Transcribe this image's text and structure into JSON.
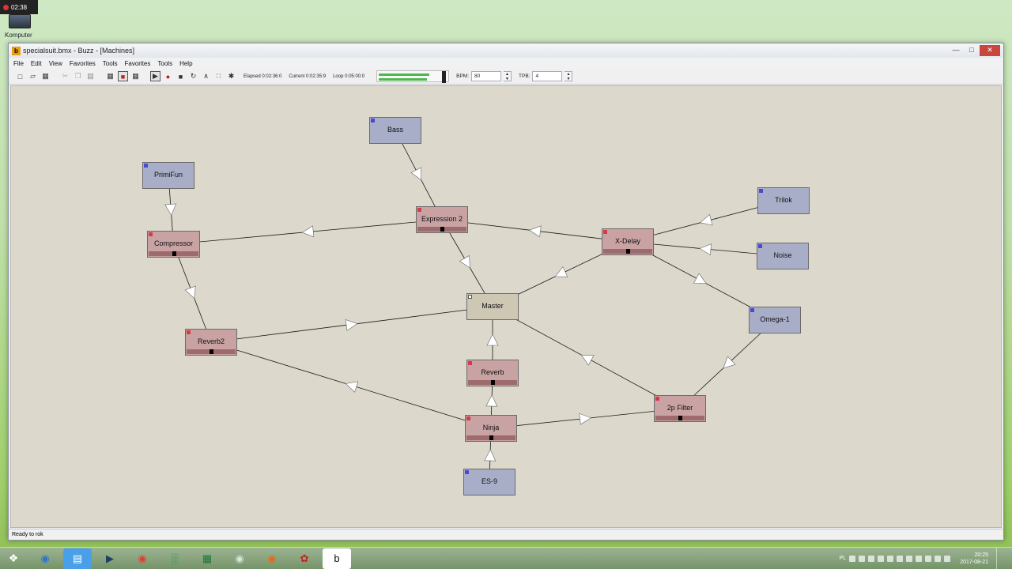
{
  "desktop": {
    "clock_badge": "02:38",
    "icon_label": "Komputer"
  },
  "window": {
    "title": "specialsuit.bmx - Buzz - [Machines]",
    "menu": [
      "File",
      "Edit",
      "View",
      "Favorites",
      "Tools",
      "Favorites",
      "Tools",
      "Help"
    ],
    "transport": {
      "elapsed": "Elapsed 0:02:36:0",
      "current": "Current 0:02:35:9",
      "loop": "Loop 0:05:00:0"
    },
    "bpm_label": "BPM:",
    "bpm_value": "80",
    "tpb_label": "TPB:",
    "tpb_value": "4",
    "vu_levels": [
      0.82,
      0.78
    ],
    "status": "Ready to rok"
  },
  "machines": [
    {
      "name": "Bass",
      "kind": "generator"
    },
    {
      "name": "PrimiFun",
      "kind": "generator"
    },
    {
      "name": "Expression 2",
      "kind": "effect"
    },
    {
      "name": "Compressor",
      "kind": "effect"
    },
    {
      "name": "X-Delay",
      "kind": "effect"
    },
    {
      "name": "Trilok",
      "kind": "generator"
    },
    {
      "name": "Noise",
      "kind": "generator"
    },
    {
      "name": "Master",
      "kind": "master"
    },
    {
      "name": "Omega-1",
      "kind": "generator"
    },
    {
      "name": "Reverb2",
      "kind": "effect"
    },
    {
      "name": "Reverb",
      "kind": "effect"
    },
    {
      "name": "2p Filter",
      "kind": "effect"
    },
    {
      "name": "Ninja",
      "kind": "effect"
    },
    {
      "name": "ES-9",
      "kind": "generator"
    }
  ],
  "connections": [
    [
      "Bass",
      "Expression 2"
    ],
    [
      "PrimiFun",
      "Compressor"
    ],
    [
      "Expression 2",
      "Compressor"
    ],
    [
      "Expression 2",
      "Master"
    ],
    [
      "X-Delay",
      "Expression 2"
    ],
    [
      "Trilok",
      "X-Delay"
    ],
    [
      "Noise",
      "X-Delay"
    ],
    [
      "X-Delay",
      "Omega-1"
    ],
    [
      "X-Delay",
      "Master"
    ],
    [
      "Compressor",
      "Reverb2"
    ],
    [
      "Reverb2",
      "Master"
    ],
    [
      "Reverb",
      "Master"
    ],
    [
      "Ninja",
      "Reverb"
    ],
    [
      "ES-9",
      "Ninja"
    ],
    [
      "Ninja",
      "Reverb2"
    ],
    [
      "Ninja",
      "2p Filter"
    ],
    [
      "2p Filter",
      "Master"
    ],
    [
      "Omega-1",
      "2p Filter"
    ]
  ],
  "taskbar": {
    "apps": [
      "windows-start",
      "app-blue",
      "explorer",
      "media-player",
      "chrome",
      "monitor",
      "excel",
      "speaker",
      "firefox",
      "game",
      "buzz"
    ],
    "tray_lang": "PL",
    "time": "20:25",
    "date": "2017-08-21"
  }
}
